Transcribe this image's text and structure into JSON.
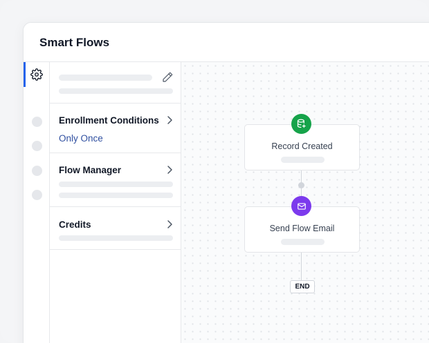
{
  "app": {
    "title": "Smart Flows"
  },
  "rail": {
    "items": [
      {
        "icon": "gear-icon",
        "active": true
      },
      {
        "icon": "placeholder-dot"
      },
      {
        "icon": "placeholder-dot"
      },
      {
        "icon": "placeholder-dot"
      },
      {
        "icon": "placeholder-dot"
      }
    ],
    "accent": "#2563eb"
  },
  "panel": {
    "edit_icon": "pencil-icon",
    "sections": [
      {
        "title": "Enrollment Conditions",
        "value": "Only Once",
        "icon": "chevron-right-icon"
      },
      {
        "title": "Flow Manager",
        "icon": "chevron-right-icon"
      },
      {
        "title": "Credits",
        "icon": "chevron-right-icon"
      }
    ]
  },
  "flow": {
    "nodes": [
      {
        "label": "Record Created",
        "icon": "database-icon",
        "color": "#16a34a"
      },
      {
        "label": "Send Flow Email",
        "icon": "mail-icon",
        "color": "#7c3aed"
      }
    ],
    "end_label": "END"
  }
}
